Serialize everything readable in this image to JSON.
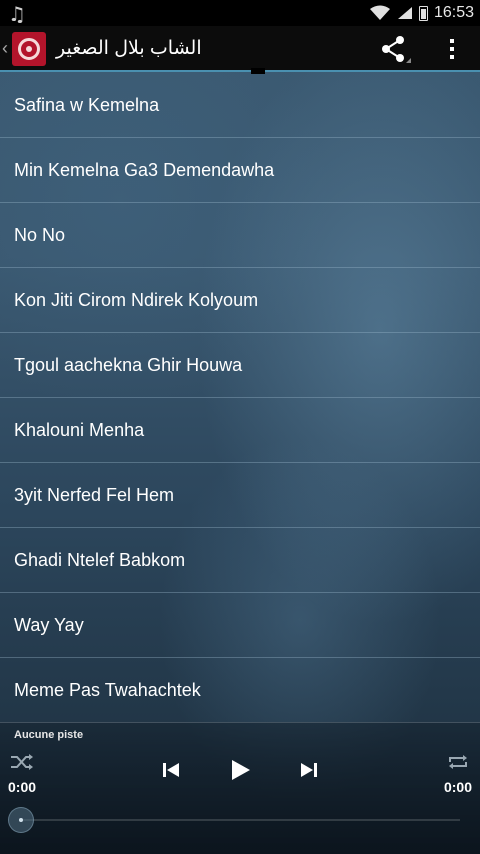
{
  "status_bar": {
    "time": "16:53",
    "icons": [
      "music-note-icon",
      "wifi-icon",
      "signal-icon",
      "battery-icon"
    ]
  },
  "action_bar": {
    "title": "الشاب بلال الصغير",
    "icons": [
      "back-chevron-icon",
      "app-logo-icon",
      "share-icon",
      "overflow-menu-icon"
    ]
  },
  "songs": [
    "Safina w Kemelna",
    "Min Kemelna Ga3 Demendawha",
    "No No",
    "Kon Jiti Cirom Ndirek Kolyoum",
    "Tgoul aachekna Ghir Houwa",
    "Khalouni Menha",
    "3yit Nerfed Fel Hem",
    "Ghadi Ntelef Babkom",
    "Way Yay",
    "Meme Pas Twahachtek"
  ],
  "player": {
    "track_name": "Aucune piste",
    "elapsed": "0:00",
    "duration": "0:00",
    "progress": 0,
    "icons": [
      "shuffle-icon",
      "previous-icon",
      "play-icon",
      "next-icon",
      "repeat-icon"
    ]
  },
  "colors": {
    "accent": "#4a90b0",
    "action_bar": "#0c0c0c",
    "app_icon": "#b3142b"
  }
}
